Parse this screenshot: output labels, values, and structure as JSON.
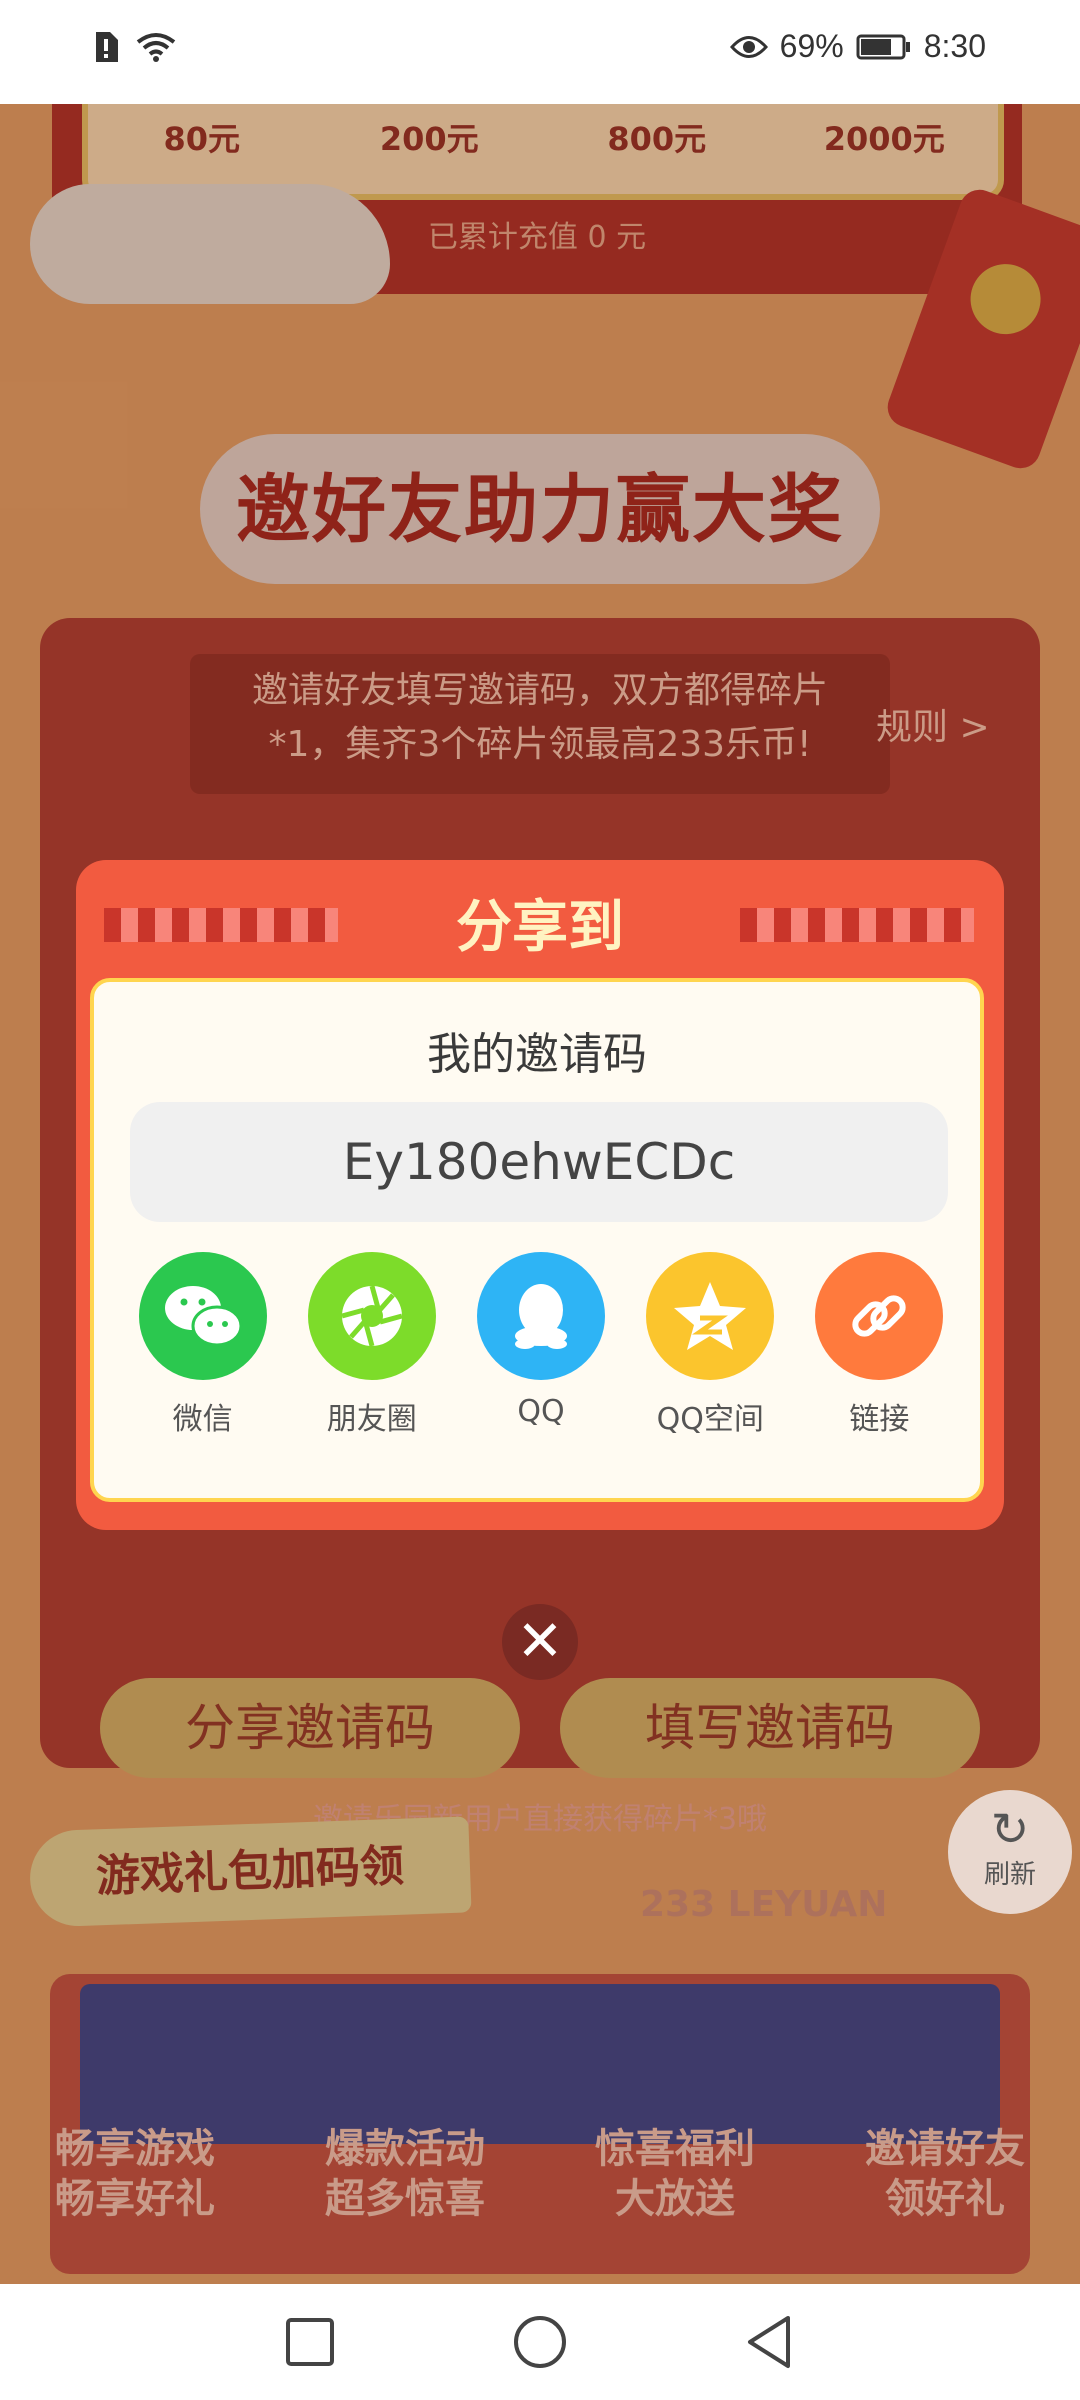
{
  "status_bar": {
    "battery_percent": "69%",
    "time": "8:30",
    "icons": [
      "sim-alert-icon",
      "wifi-icon",
      "eye-icon",
      "battery-icon"
    ]
  },
  "background": {
    "tiers": [
      "80元",
      "200元",
      "800元",
      "2000元"
    ],
    "total_recharge": "已累计充值 0 元",
    "section_title": "邀好友助力赢大奖",
    "invite_hint": "邀请好友填写邀请码，双方都得碎片*1，集齐3个碎片领最高233乐币!",
    "rules_link": "规则 >",
    "share_code_button": "分享邀请码",
    "fill_code_button": "填写邀请码",
    "invite_sub": "邀请乐园新用户直接获得碎片*3哦",
    "gift_tag": "游戏礼包加码领",
    "leyuan_label": "233 LEYUAN",
    "features": [
      {
        "line1": "畅享游戏",
        "line2": "畅享好礼"
      },
      {
        "line1": "爆款活动",
        "line2": "超多惊喜"
      },
      {
        "line1": "惊喜福利",
        "line2": "大放送"
      },
      {
        "line1": "邀请好友",
        "line2": "领好礼"
      }
    ],
    "refresh_label": "刷新"
  },
  "dialog": {
    "title": "分享到",
    "code_label": "我的邀请码",
    "code_value": "Ey180ehwECDc",
    "share_targets": [
      {
        "label": "微信",
        "color": "#2bc84f",
        "icon": "wechat-icon"
      },
      {
        "label": "朋友圈",
        "color": "#7ddc2a",
        "icon": "moments-icon"
      },
      {
        "label": "QQ",
        "color": "#2eb4f5",
        "icon": "qq-icon"
      },
      {
        "label": "QQ空间",
        "color": "#fbc52d",
        "icon": "qzone-icon"
      },
      {
        "label": "链接",
        "color": "#ff7a3d",
        "icon": "link-icon"
      }
    ],
    "close_symbol": "✕"
  },
  "colors": {
    "dialog_red": "#f25b40",
    "title_cream": "#fff3c2",
    "border_yellow": "#ffd54f"
  }
}
